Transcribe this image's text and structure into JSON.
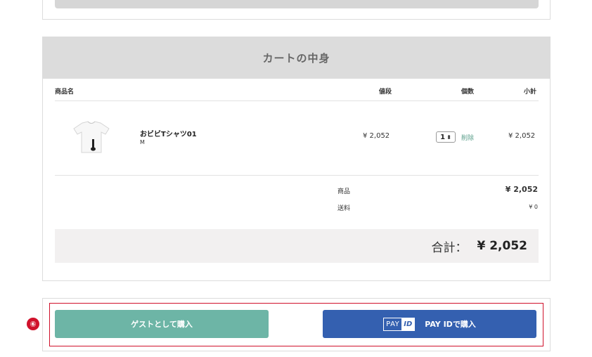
{
  "cart": {
    "title": "カートの中身",
    "columns": {
      "product": "商品名",
      "price": "値段",
      "quantity": "個数",
      "subtotal": "小計"
    },
    "item": {
      "name": "おビビTシャツ01",
      "variant": "M",
      "price": "¥ 2,052",
      "quantity": "1",
      "delete_label": "削除",
      "subtotal": "¥ 2,052"
    },
    "summary": {
      "goods_label": "商品",
      "goods_value": "¥ 2,052",
      "shipping_label": "送料",
      "shipping_value": "¥ 0"
    },
    "total": {
      "label": "合計：",
      "value": "¥ 2,052"
    }
  },
  "buttons": {
    "guest_purchase": "ゲストとして購入",
    "payid_logo_pay": "PAY",
    "payid_logo_id": "ID",
    "payid_purchase": "PAY IDで購入"
  },
  "annotation": {
    "marker": "⑥"
  },
  "colors": {
    "guest_button": "#6db5a6",
    "payid_button": "#3460b0",
    "highlight": "#d0112b",
    "delete_link": "#5a9e8a"
  }
}
